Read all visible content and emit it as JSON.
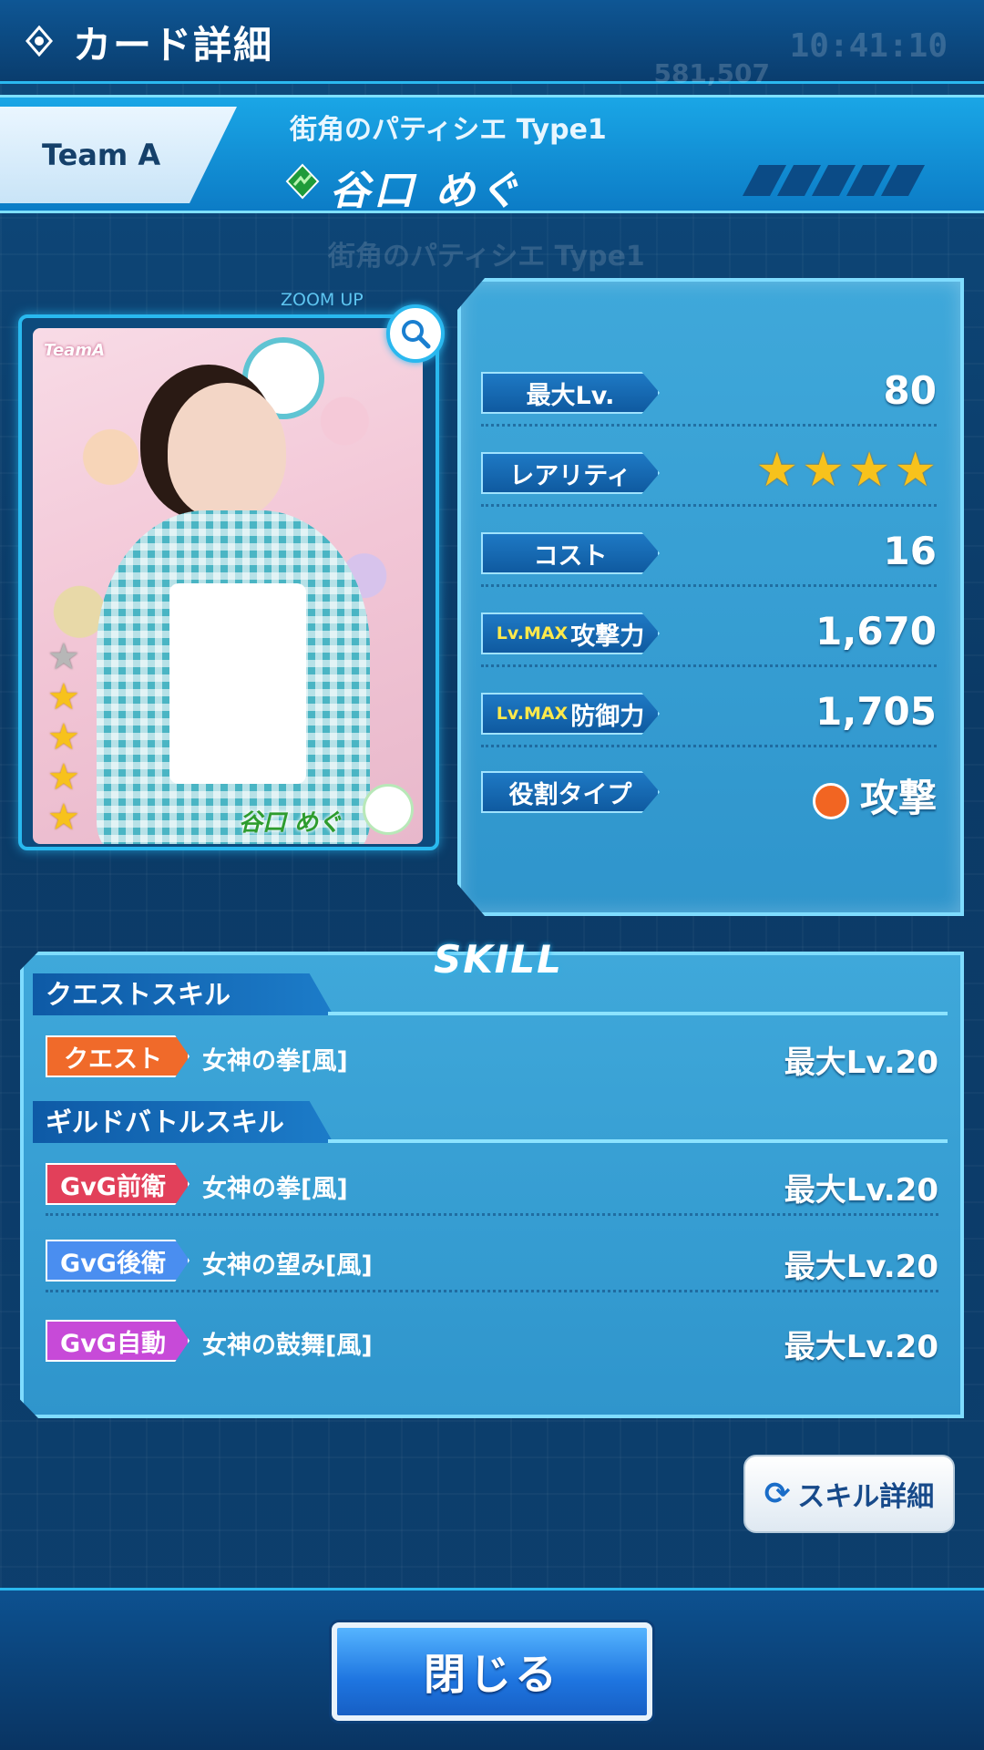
{
  "header": {
    "title": "カード詳細",
    "ghost_timer": "10:41:10",
    "ghost_count": "581,507"
  },
  "banner": {
    "team": "Team A",
    "card_title": "街角のパティシエ Type1",
    "member_name": "谷口 めぐ"
  },
  "card": {
    "zoom_label": "ZOOM UP",
    "image_tag": "TeamA",
    "image_caption": "谷口 めぐ",
    "stars_filled": 4,
    "stars_total": 5
  },
  "stats": {
    "max_lv_label": "最大Lv.",
    "max_lv": "80",
    "rarity_label": "レアリティ",
    "rarity_stars": 4,
    "cost_label": "コスト",
    "cost": "16",
    "attack_prefix": "Lv.MAX",
    "attack_label": "攻撃力",
    "attack": "1,670",
    "defense_prefix": "Lv.MAX",
    "defense_label": "防御力",
    "defense": "1,705",
    "role_label": "役割タイプ",
    "role": "攻撃"
  },
  "skill": {
    "heading": "SKILL",
    "quest_section": "クエストスキル",
    "guild_section": "ギルドバトルスキル",
    "rows": [
      {
        "tag": "クエスト",
        "name": "女神の拳[風]",
        "lv": "最大Lv.20",
        "color": "#f06a2a"
      },
      {
        "tag": "GvG前衛",
        "name": "女神の拳[風]",
        "lv": "最大Lv.20",
        "color": "#e2405a"
      },
      {
        "tag": "GvG後衛",
        "name": "女神の望み[風]",
        "lv": "最大Lv.20",
        "color": "#4a8ef0"
      },
      {
        "tag": "GvG自動",
        "name": "女神の鼓舞[風]",
        "lv": "最大Lv.20",
        "color": "#c74ad8"
      }
    ],
    "detail_button": "スキル詳細"
  },
  "footer": {
    "close_button": "閉じる"
  }
}
